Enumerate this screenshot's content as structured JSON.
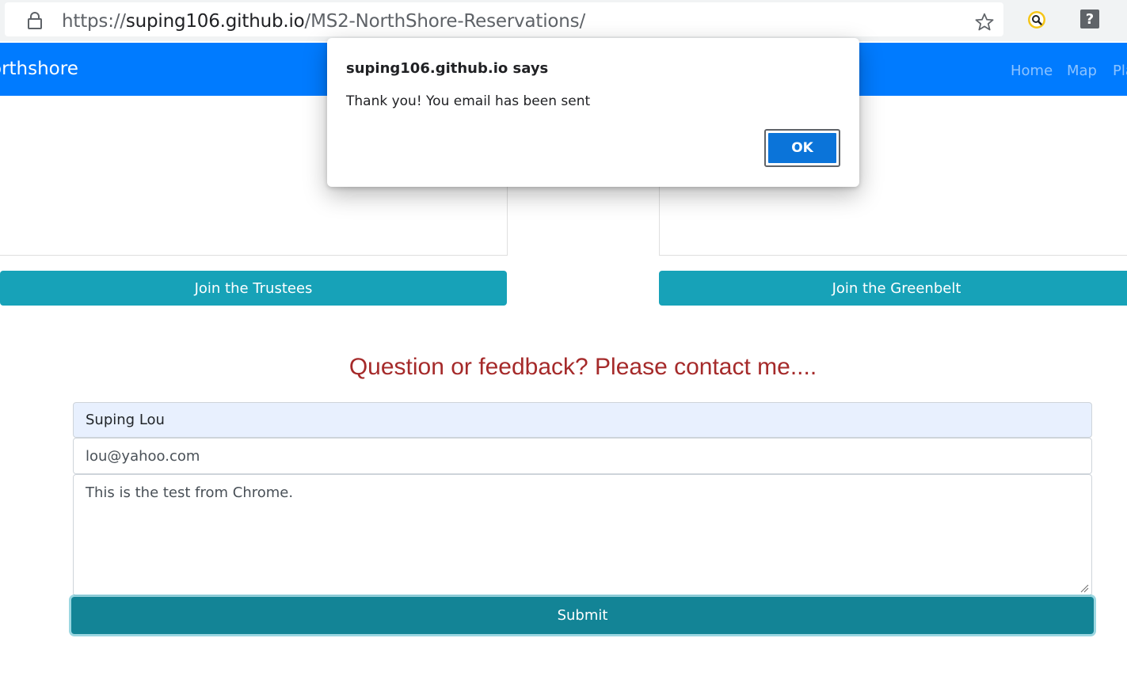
{
  "browser": {
    "url_scheme": "https://",
    "url_host": "suping106.github.io",
    "url_path": "/MS2-NorthShore-Reservations/",
    "lock_icon": "lock-icon",
    "bookmark_icon": "star-icon",
    "extensions": [
      "search-extension-icon",
      "help-extension-icon"
    ]
  },
  "navbar": {
    "brand": "orthshore",
    "links": [
      "Home",
      "Map",
      "Pla"
    ],
    "color": "#007bff"
  },
  "cards": {
    "left_button": "Join the Trustees",
    "right_button": "Join the Greenbelt",
    "button_color": "#17a2b8"
  },
  "contact": {
    "title": "Question or feedback? Please contact me....",
    "title_color": "#a52a2a",
    "name_value": "Suping Lou",
    "email_value": "lou@yahoo.com",
    "message_value": "This is the test from Chrome.",
    "submit_label": "Submit"
  },
  "dialog": {
    "title": "suping106.github.io says",
    "message": "Thank you! You email has been sent",
    "ok_label": "OK",
    "ok_color": "#0b74d9"
  }
}
